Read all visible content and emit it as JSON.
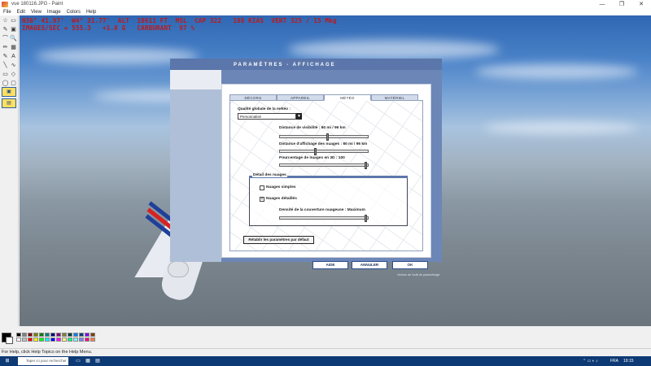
{
  "window": {
    "title": "vue 180116.JPG - Paint",
    "minimize_glyph": "—",
    "maximize_glyph": "❐",
    "close_glyph": "✕"
  },
  "menu": [
    "File",
    "Edit",
    "View",
    "Image",
    "Colors",
    "Help"
  ],
  "tools": [
    "☆",
    "▭",
    "✎",
    "▣",
    "⌒",
    "🔍",
    "✏",
    "▦",
    "✎",
    "A",
    "╲",
    "∿",
    "▭",
    "◇",
    "◯",
    "▢"
  ],
  "hud": {
    "line1": "N36° 41.97'  W4° 31.77'  ALT  18611 FT  MSL  CAP 322   198 KIAS  VENT 325 / 15 Mkg",
    "line2": "IMAGES/SEC = 555.3   +1.0 G   CARBURANT  97 %"
  },
  "dialog": {
    "header": "PARAMÈTRES - AFFICHAGE",
    "tabs": [
      {
        "label": "DÉCORS",
        "active": false
      },
      {
        "label": "APPAREIL",
        "active": false
      },
      {
        "label": "MÉTÉO",
        "active": true
      },
      {
        "label": "MATÉRIEL",
        "active": false
      }
    ],
    "quality_label": "Qualité globale de la météo :",
    "quality_value": "Personnalisé",
    "combo_arrow": "▼",
    "visibility_label": "Distance de visibilité : 60 mi / 96 km",
    "visibility_value": 0.55,
    "cloud_distance_label": "Distance d'affichage des nuages : 60 mi / 96 km",
    "cloud_distance_value": 0.4,
    "cloud_3d_label": "Pourcentage de nuages en 3D : 100",
    "cloud_3d_value": 1.0,
    "group_title": "Détail des nuages",
    "simple_clouds_label": "Nuages simples",
    "simple_clouds_checked": false,
    "detailed_clouds_label": "Nuages détaillés",
    "detailed_clouds_checked": true,
    "checkmark": "×",
    "density_label": "Densité de la couverture nuageuse : Maximum",
    "density_value": 1.0,
    "reset_button": "Rétablir les paramètres par défaut",
    "help_button": "AIDE",
    "cancel_button": "ANNULER",
    "ok_button": "OK",
    "footnote": "Version de l'outil de paramétrage"
  },
  "palette": {
    "colors_row1": [
      "#000000",
      "#808080",
      "#800000",
      "#808000",
      "#008000",
      "#008080",
      "#000080",
      "#800080",
      "#808040",
      "#004040",
      "#0080ff",
      "#004080",
      "#8000ff",
      "#804000"
    ],
    "colors_row2": [
      "#ffffff",
      "#c0c0c0",
      "#ff0000",
      "#ffff00",
      "#00ff00",
      "#00ffff",
      "#0000ff",
      "#ff00ff",
      "#ffff80",
      "#00ff80",
      "#80ffff",
      "#8080ff",
      "#ff0080",
      "#ff8040"
    ]
  },
  "statusbar": {
    "text": "For Help, click Help Topics on the Help Menu."
  },
  "taskbar": {
    "start_glyph": "⊞",
    "search_placeholder": "Taper ici pour rechercher",
    "tray_lang": "FRA",
    "tray_time": "19:15"
  }
}
